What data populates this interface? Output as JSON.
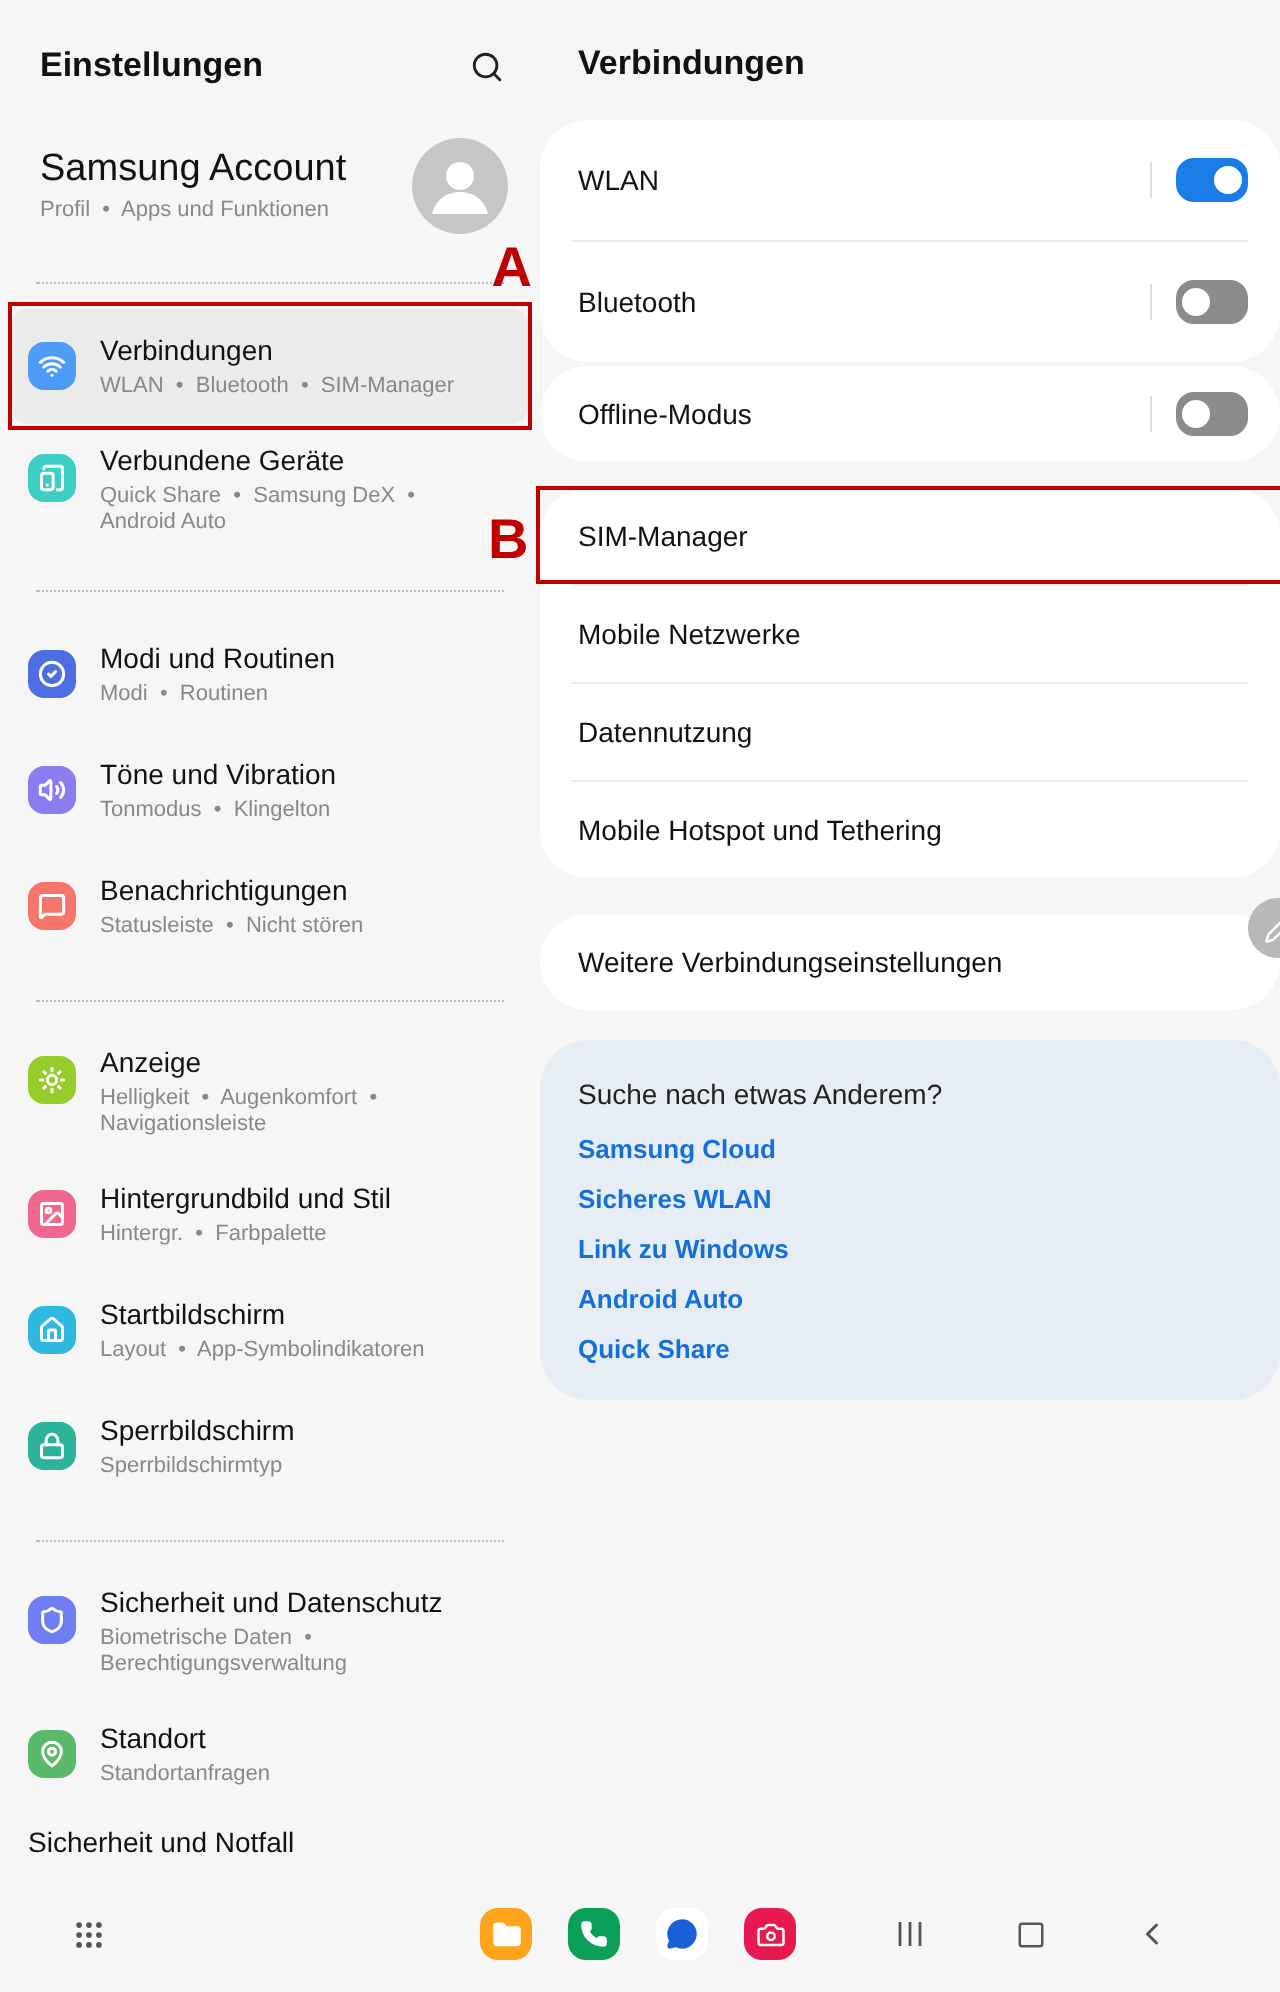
{
  "sidebar": {
    "title": "Einstellungen",
    "account": {
      "name": "Samsung Account",
      "subtitle": "Profil  •  Apps und Funktionen"
    },
    "groups": [
      {
        "items": [
          {
            "kind": "wifi",
            "color": "#4e9bf8",
            "title": "Verbindungen",
            "subtitle": "WLAN  •  Bluetooth  •  SIM-Manager",
            "selected": true,
            "annotation": "A"
          },
          {
            "kind": "devices",
            "color": "#3dcfc4",
            "title": "Verbundene Geräte",
            "subtitle": "Quick Share  •  Samsung DeX  •  Android Auto",
            "selected": false
          }
        ]
      },
      {
        "items": [
          {
            "kind": "modes",
            "color": "#4b6fe0",
            "title": "Modi und Routinen",
            "subtitle": "Modi  •  Routinen",
            "selected": false
          },
          {
            "kind": "sound",
            "color": "#8b7cf2",
            "title": "Töne und Vibration",
            "subtitle": "Tonmodus  •  Klingelton",
            "selected": false
          },
          {
            "kind": "notify",
            "color": "#f7766b",
            "title": "Benachrichtigungen",
            "subtitle": "Statusleiste  •  Nicht stören",
            "selected": false
          }
        ]
      },
      {
        "items": [
          {
            "kind": "display",
            "color": "#96cc2b",
            "title": "Anzeige",
            "subtitle": "Helligkeit  •  Augenkomfort  •  Navigationsleiste",
            "selected": false
          },
          {
            "kind": "wallpaper",
            "color": "#f0688f",
            "title": "Hintergrundbild und Stil",
            "subtitle": "Hintergr.  •  Farbpalette",
            "selected": false
          },
          {
            "kind": "home",
            "color": "#2fb9e0",
            "title": "Startbildschirm",
            "subtitle": "Layout  •  App-Symbolindikatoren",
            "selected": false
          },
          {
            "kind": "lock",
            "color": "#2db39a",
            "title": "Sperrbildschirm",
            "subtitle": "Sperrbildschirmtyp",
            "selected": false
          }
        ]
      },
      {
        "items": [
          {
            "kind": "shield",
            "color": "#6f7ef2",
            "title": "Sicherheit und Datenschutz",
            "subtitle": "Biometrische Daten  •  Berechtigungsverwaltung",
            "selected": false
          },
          {
            "kind": "location",
            "color": "#5bb96a",
            "title": "Standort",
            "subtitle": "Standortanfragen",
            "selected": false
          },
          {
            "kind": "plain",
            "title": "Sicherheit und Notfall",
            "selected": false
          }
        ]
      }
    ]
  },
  "detail": {
    "title": "Verbindungen",
    "cards": [
      {
        "rows": [
          {
            "kind": "toggle",
            "label": "WLAN",
            "on": true
          },
          {
            "kind": "toggle",
            "label": "Bluetooth",
            "on": false
          }
        ]
      },
      {
        "rows": [
          {
            "kind": "toggle",
            "label": "Offline-Modus",
            "on": false
          }
        ]
      },
      {
        "rows": [
          {
            "kind": "link",
            "label": "SIM-Manager",
            "annotation": "B"
          },
          {
            "kind": "link",
            "label": "Mobile Netzwerke"
          },
          {
            "kind": "link",
            "label": "Datennutzung"
          },
          {
            "kind": "link",
            "label": "Mobile Hotspot und Tethering"
          }
        ]
      },
      {
        "rows": [
          {
            "kind": "link",
            "label": "Weitere Verbindungseinstellungen"
          }
        ]
      }
    ],
    "suggestions": {
      "title": "Suche nach etwas Anderem?",
      "links": [
        "Samsung Cloud",
        "Sicheres WLAN",
        "Link zu Windows",
        "Android Auto",
        "Quick Share"
      ]
    }
  }
}
